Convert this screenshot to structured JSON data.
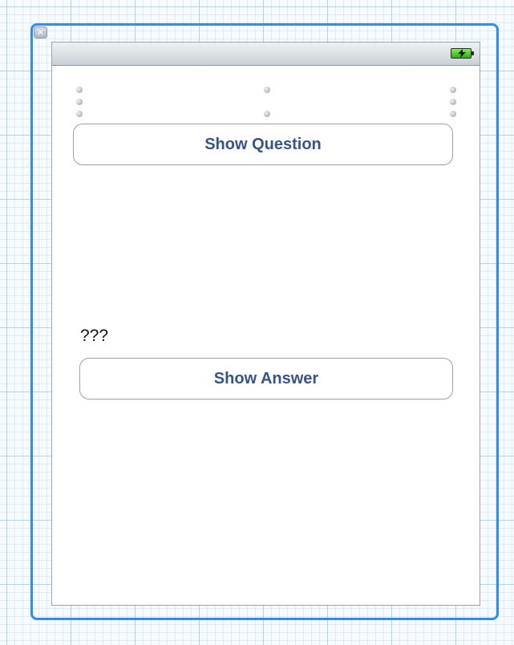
{
  "window": {
    "close_glyph": "✕",
    "close_icon": "close-icon"
  },
  "status_bar": {
    "battery_icon": "battery-charging-icon",
    "battery_color": "#3fce1f"
  },
  "buttons": {
    "show_question_label": "Show Question",
    "show_answer_label": "Show Answer",
    "text_color": "#385487"
  },
  "labels": {
    "answer_placeholder": "???"
  },
  "colors": {
    "selection_frame": "#2f8cf0",
    "canvas_grid": "#8cbee6"
  }
}
